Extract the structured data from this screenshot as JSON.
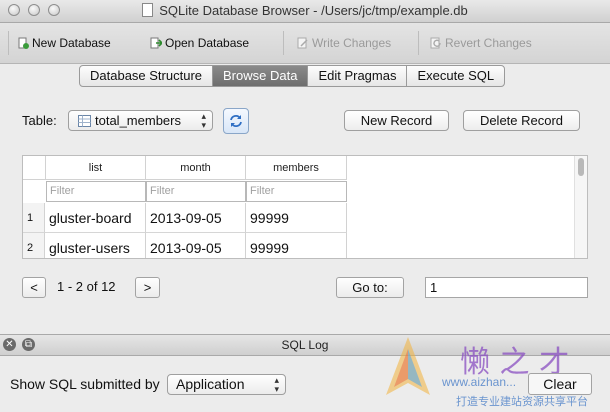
{
  "window": {
    "title": "SQLite Database Browser - /Users/jc/tmp/example.db"
  },
  "toolbar": {
    "new_database": "New Database",
    "open_database": "Open Database",
    "write_changes": "Write Changes",
    "revert_changes": "Revert Changes"
  },
  "tabs": [
    {
      "label": "Database Structure",
      "active": false
    },
    {
      "label": "Browse Data",
      "active": true
    },
    {
      "label": "Edit Pragmas",
      "active": false
    },
    {
      "label": "Execute SQL",
      "active": false
    }
  ],
  "browse": {
    "table_label": "Table:",
    "table_selected": "total_members",
    "new_record": "New Record",
    "delete_record": "Delete Record"
  },
  "grid": {
    "columns": [
      "list",
      "month",
      "members"
    ],
    "filter_placeholder": "Filter",
    "rows": [
      {
        "num": "1",
        "cells": [
          "gluster-board",
          "2013-09-05",
          "99999"
        ]
      },
      {
        "num": "2",
        "cells": [
          "gluster-users",
          "2013-09-05",
          "99999"
        ]
      }
    ]
  },
  "pager": {
    "prev": "<",
    "next": ">",
    "range": "1 - 2 of 12",
    "goto_label": "Go to:",
    "goto_value": "1"
  },
  "sql_log": {
    "title": "SQL Log",
    "show_label": "Show SQL submitted by",
    "source_selected": "Application",
    "clear": "Clear"
  },
  "watermark": {
    "text": "懒 之 才",
    "url": "www.aizhan...",
    "tagline": "打造专业建站资源共享平台"
  },
  "colors": {
    "active_tab": "#7a7a7a",
    "accent_blue": "#2f6fc4",
    "watermark_purple": "#8a4fc2"
  }
}
